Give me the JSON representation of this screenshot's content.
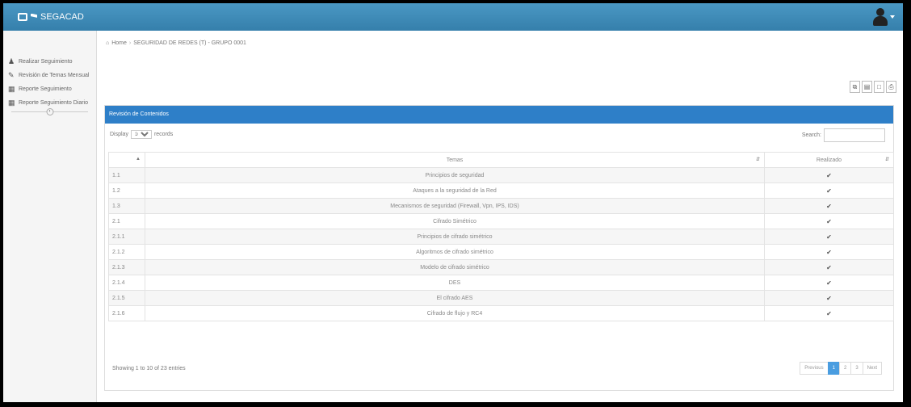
{
  "app": {
    "name": "SEGACAD"
  },
  "icons": {
    "brand_logo": "logo-box-icon",
    "user": "user-avatar-icon",
    "home": "home-icon",
    "check": "check-icon"
  },
  "colors": {
    "topbar": "#3c8dbc",
    "panel_header": "#2e7fc8",
    "page_active": "#4a9de0"
  },
  "sidebar": {
    "items": [
      {
        "label": "Realizar Seguimiento",
        "icon": "user-icon"
      },
      {
        "label": "Revisión de Temas Mensual",
        "icon": "edit-icon"
      },
      {
        "label": "Reporte Seguimiento",
        "icon": "table-icon"
      },
      {
        "label": "Reporte Seguimiento Diario",
        "icon": "table-icon"
      }
    ]
  },
  "breadcrumb": {
    "home": "Home",
    "current": "SEGURIDAD DE REDES (T) - GRUPO 0001"
  },
  "panel": {
    "title": "Revisión de Contenidos"
  },
  "table_controls": {
    "display_label": "Display",
    "records_label": "records",
    "length_value": "10",
    "search_label": "Search:"
  },
  "table": {
    "columns": [
      "",
      "Temas",
      "Realizado"
    ],
    "rows": [
      {
        "num": "1.1",
        "topic": "Principios de seguridad",
        "done": "✔"
      },
      {
        "num": "1.2",
        "topic": "Ataques a la seguridad de la Red",
        "done": "✔"
      },
      {
        "num": "1.3",
        "topic": "Mecanismos de seguridad (Firewall, Vpn, IPS, IDS)",
        "done": "✔"
      },
      {
        "num": "2.1",
        "topic": "Cifrado Simétrico",
        "done": "✔"
      },
      {
        "num": "2.1.1",
        "topic": "Principios de cifrado simétrico",
        "done": "✔"
      },
      {
        "num": "2.1.2",
        "topic": "Algoritmos de cifrado simétrico",
        "done": "✔"
      },
      {
        "num": "2.1.3",
        "topic": "Modelo de cifrado simétrico",
        "done": "✔"
      },
      {
        "num": "2.1.4",
        "topic": "DES",
        "done": "✔"
      },
      {
        "num": "2.1.5",
        "topic": "El cifrado AES",
        "done": "✔"
      },
      {
        "num": "2.1.6",
        "topic": "Cifrado de flujo y RC4",
        "done": "✔"
      }
    ]
  },
  "footer": {
    "info": "Showing 1 to 10 of 23 entries",
    "pager": {
      "previous": "Previous",
      "pages": [
        "1",
        "2",
        "3"
      ],
      "active_page": "1",
      "next": "Next"
    }
  }
}
